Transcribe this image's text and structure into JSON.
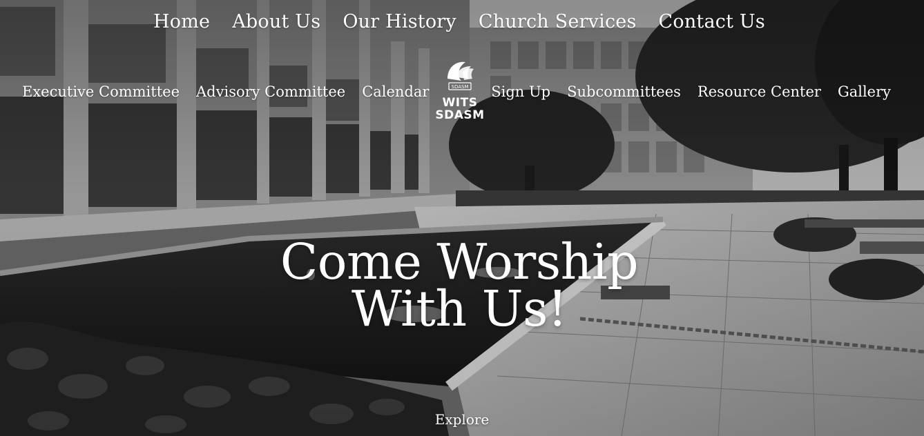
{
  "site": {
    "logo_line1": "WITS",
    "logo_line2": "SDASM",
    "logo_badge": "SDASM"
  },
  "top_nav": {
    "items": [
      {
        "label": "Home"
      },
      {
        "label": "About Us"
      },
      {
        "label": "Our History"
      },
      {
        "label": "Church Services"
      },
      {
        "label": "Contact Us"
      }
    ]
  },
  "sub_nav_left": {
    "items": [
      {
        "label": "Executive Committee"
      },
      {
        "label": "Advisory Committee"
      },
      {
        "label": "Calendar"
      }
    ]
  },
  "sub_nav_right": {
    "items": [
      {
        "label": "Sign Up"
      },
      {
        "label": "Subcommittees"
      },
      {
        "label": "Resource Center"
      },
      {
        "label": "Gallery"
      }
    ]
  },
  "hero": {
    "headline_line1": "Come Worship",
    "headline_line2": "With Us!",
    "cta": "Explore"
  }
}
